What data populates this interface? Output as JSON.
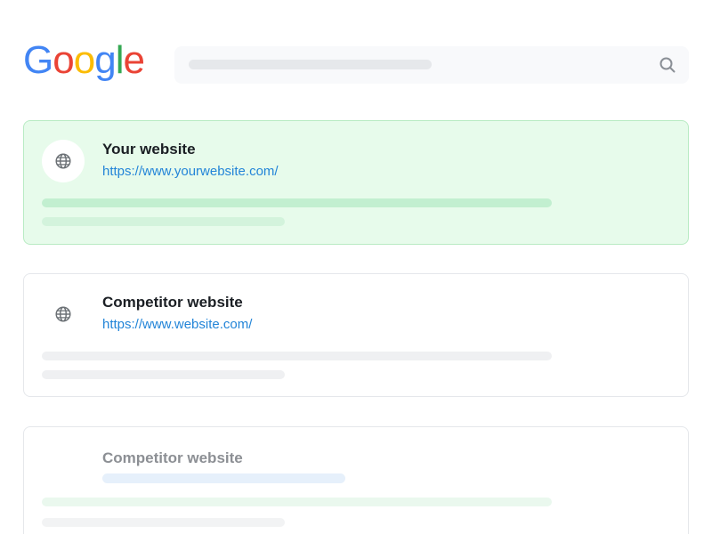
{
  "header": {
    "logo": {
      "letters": [
        "G",
        "o",
        "o",
        "g",
        "l",
        "e"
      ],
      "colors": [
        "#4285F4",
        "#EA4335",
        "#FBBC05",
        "#4285F4",
        "#34A853",
        "#EA4335"
      ]
    },
    "search": {
      "icon": "search-icon"
    }
  },
  "results": [
    {
      "title": "Your website",
      "url": "https://www.yourwebsite.com/",
      "icon": "globe-icon",
      "highlighted": true,
      "accent_color": "#e7fbeb"
    },
    {
      "title": "Competitor website",
      "url": "https://www.website.com/",
      "icon": "globe-icon",
      "highlighted": false
    },
    {
      "title": "Competitor website",
      "url": "",
      "highlighted": false
    }
  ],
  "colors": {
    "link": "#2385d8",
    "title": "#1b1f24",
    "faded_title": "#8c8f94"
  }
}
